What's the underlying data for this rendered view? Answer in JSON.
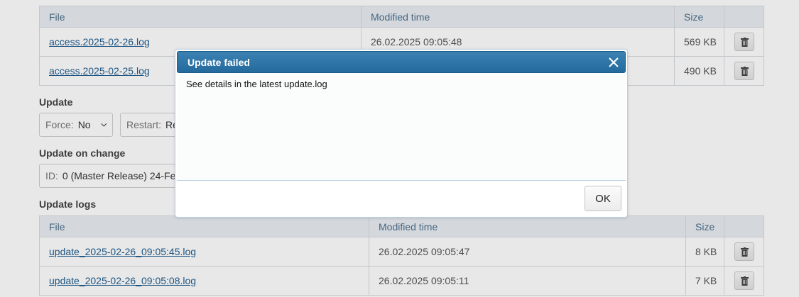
{
  "access_logs": {
    "headers": {
      "file": "File",
      "modified": "Modified time",
      "size": "Size"
    },
    "rows": [
      {
        "file": "access.2025-02-26.log",
        "modified": "26.02.2025 09:05:48",
        "size": "569 KB"
      },
      {
        "file": "access.2025-02-25.log",
        "modified": "",
        "size": "490 KB"
      }
    ]
  },
  "update": {
    "title": "Update",
    "force_label": "Force:",
    "force_value": "No",
    "restart_label": "Restart:",
    "restart_value": "Re"
  },
  "update_on_change": {
    "title": "Update on change",
    "id_label": "ID:",
    "id_value": "0 (Master Release) 24-Feb-"
  },
  "update_logs": {
    "title": "Update logs",
    "headers": {
      "file": "File",
      "modified": "Modified time",
      "size": "Size"
    },
    "rows": [
      {
        "file": "update_2025-02-26_09:05:45.log",
        "modified": "26.02.2025 09:05:47",
        "size": "8 KB"
      },
      {
        "file": "update_2025-02-26_09:05:08.log",
        "modified": "26.02.2025 09:05:11",
        "size": "7 KB"
      }
    ]
  },
  "dialog": {
    "title": "Update failed",
    "message": "See details in the latest update.log",
    "ok_label": "OK"
  },
  "icons": {
    "delete": "trash-icon",
    "close": "close-icon",
    "dropdown": "chevron-down-icon"
  },
  "colors": {
    "dialog_header": "#2d74a6",
    "link": "#1f5d8f",
    "header_text": "#4d6f8c"
  }
}
